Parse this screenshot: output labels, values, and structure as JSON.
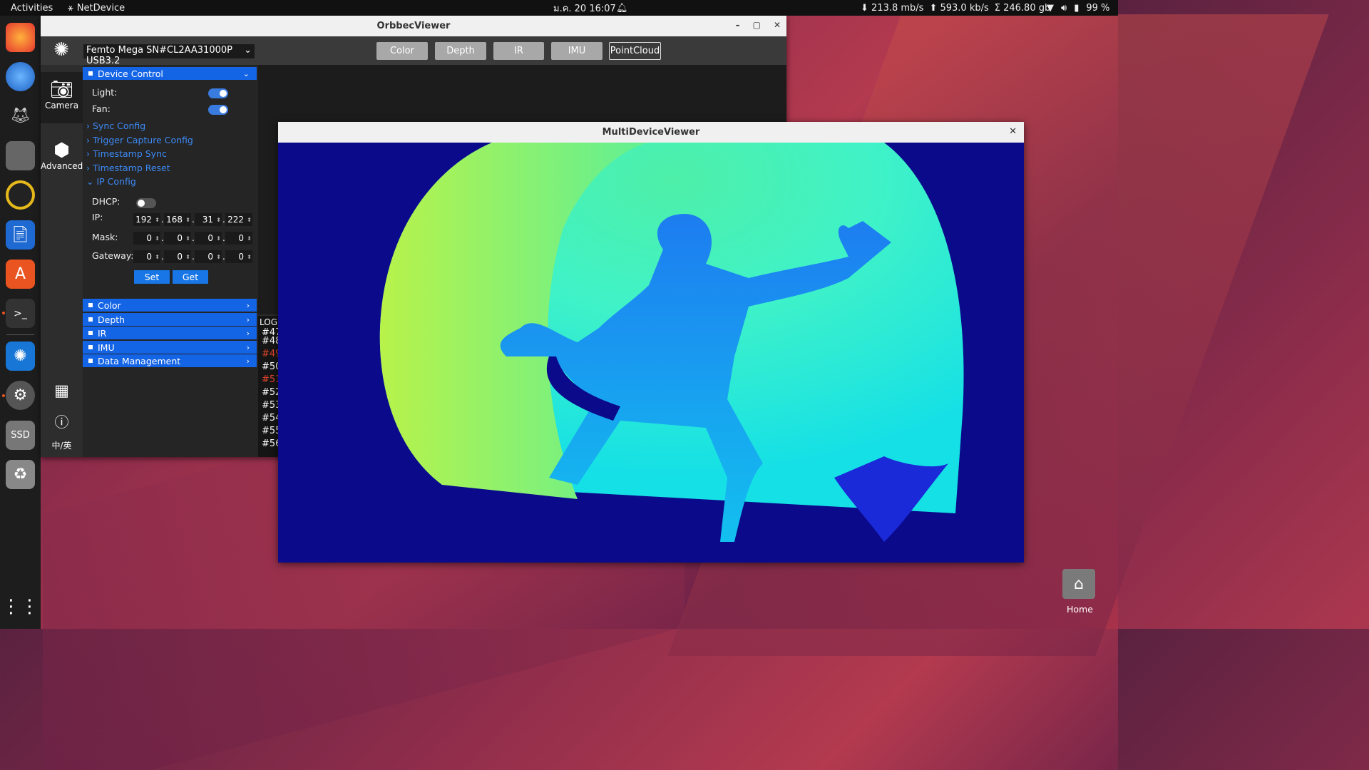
{
  "topbar": {
    "activities": "Activities",
    "netdevice": "NetDevice",
    "clock": "ม.ค. 20  16:07",
    "down_rate": "⬇ 213.8 mb/s",
    "up_rate": "⬆ 593.0 kb/s",
    "sum": "Σ 246.80 gb",
    "battery": "99 %"
  },
  "orbbec": {
    "title": "OrbbecViewer",
    "device_select": "Femto Mega SN#CL2AA31000P USB3.2",
    "tabs": [
      "Color",
      "Depth",
      "IR",
      "IMU",
      "PointCloud"
    ],
    "active_tab": "PointCloud",
    "nav": {
      "camera": "Camera",
      "advanced": "Advanced",
      "lang": "中/英"
    },
    "device_control": "Device Control",
    "light_label": "Light:",
    "fan_label": "Fan:",
    "light_on": true,
    "fan_on": true,
    "links": [
      "Sync Config",
      "Trigger Capture Config",
      "Timestamp Sync",
      "Timestamp Reset"
    ],
    "ip_config": "IP Config",
    "dhcp_label": "DHCP:",
    "dhcp_on": false,
    "ip_label": "IP:",
    "mask_label": "Mask:",
    "gateway_label": "Gateway:",
    "ip": [
      "192",
      "168",
      "31",
      "222"
    ],
    "mask": [
      "0",
      "0",
      "0",
      "0"
    ],
    "gateway": [
      "0",
      "0",
      "0",
      "0"
    ],
    "set_label": "Set",
    "get_label": "Get",
    "sections": [
      "Color",
      "Depth",
      "IR",
      "IMU",
      "Data Management"
    ],
    "log_title": "LOG",
    "log_lines": [
      "#47",
      "#48",
      "#49",
      "#50",
      "#51",
      "#52",
      "#53",
      "#54",
      "#55",
      "#56"
    ],
    "log_red": [
      "#49",
      "#51"
    ]
  },
  "multiview": {
    "title": "MultiDeviceViewer"
  },
  "desktop": {
    "home_label": "Home"
  },
  "colors": {
    "accent_blue": "#1464e6",
    "link_blue": "#3d8af7",
    "error_red": "#e0452b"
  }
}
